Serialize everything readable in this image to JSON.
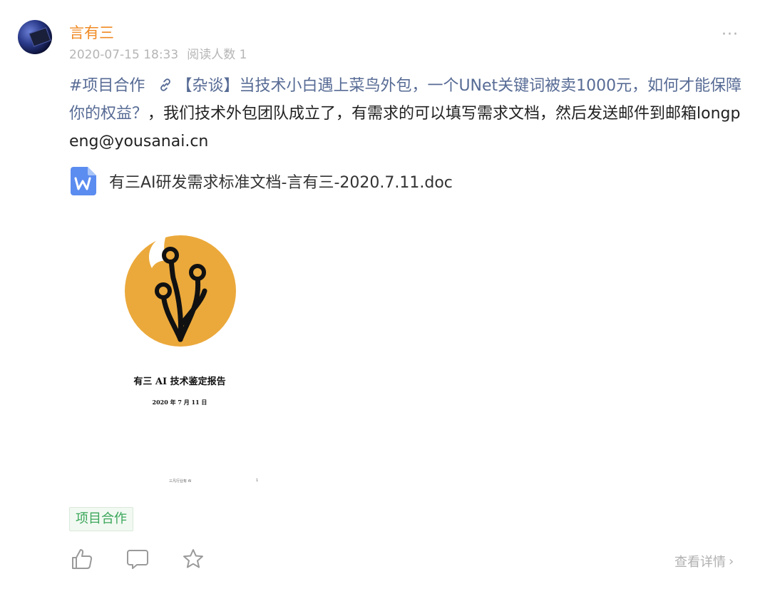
{
  "post": {
    "author": "言有三",
    "date": "2020-07-15 18:33",
    "read_count": "阅读人数 1",
    "more": "···",
    "hashtag": "#项目合作",
    "link_text": "【杂谈】当技术小白遇上菜鸟外包，一个UNet关键词被卖1000元，如何才能保障你的权益？",
    "body_text": "，我们技术外包团队成立了，有需求的可以填写需求文档，然后发送邮件到邮箱longpeng@yousanai.cn"
  },
  "attachment": {
    "filename": "有三AI研发需求标准文档-言有三-2020.7.11.doc",
    "icon": "word-doc-icon",
    "icon_color": "#5b8cf0"
  },
  "preview": {
    "title": "有三 AI 技术鉴定报告",
    "date": "2020 年 7 月 11 日",
    "footer": "三凡行业有 AI",
    "page": "1",
    "logo_color": "#eba93b"
  },
  "tag": {
    "label": "项目合作"
  },
  "actions": {
    "like_icon": "thumbs-up-icon",
    "comment_icon": "comment-icon",
    "favorite_icon": "star-icon"
  },
  "detail": {
    "label": "查看详情",
    "chevron": "›"
  },
  "colors": {
    "author": "#f08a24",
    "link": "#576b95",
    "tag_text": "#3aa65a",
    "muted": "#b0b0b0"
  }
}
